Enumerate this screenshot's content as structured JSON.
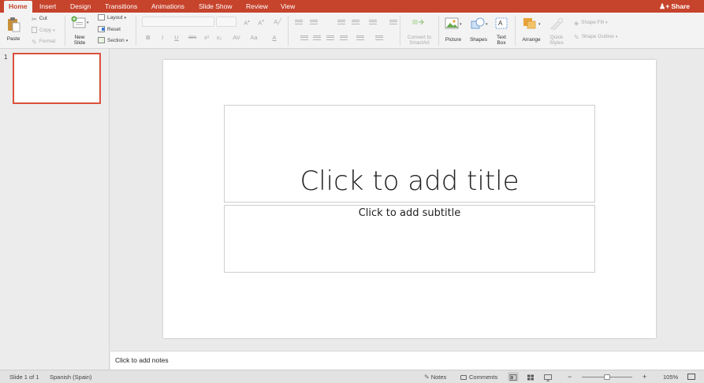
{
  "tabs": [
    "Home",
    "Insert",
    "Design",
    "Transitions",
    "Animations",
    "Slide Show",
    "Review",
    "View"
  ],
  "share_label": "Share",
  "ribbon": {
    "paste": "Paste",
    "cut": "Cut",
    "copy": "Copy",
    "format": "Format",
    "new_slide_line1": "New",
    "new_slide_line2": "Slide",
    "layout": "Layout",
    "reset": "Reset",
    "section": "Section",
    "bold": "B",
    "italic": "I",
    "underline": "U",
    "strike": "abc",
    "convert_line1": "Convert to",
    "convert_line2": "SmartArt",
    "picture": "Picture",
    "shapes": "Shapes",
    "textbox_line1": "Text",
    "textbox_line2": "Box",
    "arrange": "Arrange",
    "quick_line1": "Quick",
    "quick_line2": "Styles",
    "shape_fill": "Shape Fill",
    "shape_outline": "Shape Outline"
  },
  "thumbnail": {
    "number": "1"
  },
  "slide": {
    "title_placeholder": "Click to add title",
    "subtitle_placeholder": "Click to add subtitle"
  },
  "notes_placeholder": "Click to add notes",
  "status": {
    "slide_info": "Slide 1 of 1",
    "language": "Spanish (Spain)",
    "notes": "Notes",
    "comments": "Comments",
    "zoom": "105%",
    "zoom_minus": "−",
    "zoom_plus": "+"
  },
  "colors": {
    "accent": "#c6432c",
    "selection": "#d9523c"
  }
}
